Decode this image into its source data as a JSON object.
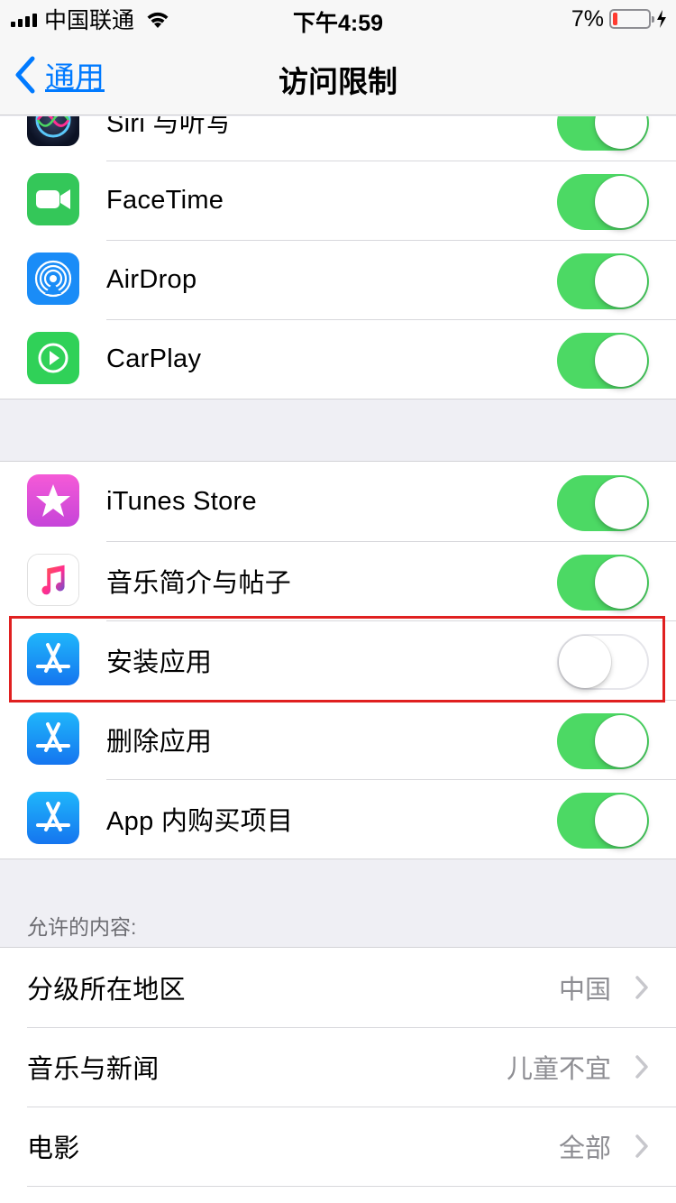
{
  "status_bar": {
    "carrier": "中国联通",
    "time": "下午4:59",
    "battery_percent": "7%",
    "battery_level": 0.07,
    "charging": true
  },
  "nav": {
    "back_label": "通用",
    "title": "访问限制"
  },
  "group1": {
    "items": [
      {
        "label": "Siri 与听写",
        "icon": "siri-icon",
        "enabled": true
      },
      {
        "label": "FaceTime",
        "icon": "facetime-icon",
        "enabled": true
      },
      {
        "label": "AirDrop",
        "icon": "airdrop-icon",
        "enabled": true
      },
      {
        "label": "CarPlay",
        "icon": "carplay-icon",
        "enabled": true
      }
    ]
  },
  "group2": {
    "items": [
      {
        "label": "iTunes Store",
        "icon": "itunes-store-icon",
        "enabled": true
      },
      {
        "label": "音乐简介与帖子",
        "icon": "music-icon",
        "enabled": true
      },
      {
        "label": "安装应用",
        "icon": "app-store-icon",
        "enabled": false,
        "highlighted": true
      },
      {
        "label": "删除应用",
        "icon": "app-store-icon",
        "enabled": true
      },
      {
        "label": "App 内购买项目",
        "icon": "app-store-icon",
        "enabled": true
      }
    ]
  },
  "allowed_content": {
    "header": "允许的内容:",
    "items": [
      {
        "label": "分级所在地区",
        "value": "中国"
      },
      {
        "label": "音乐与新闻",
        "value": "儿童不宜"
      },
      {
        "label": "电影",
        "value": "全部"
      }
    ]
  },
  "colors": {
    "accent": "#007aff",
    "toggle_on": "#4cd964",
    "highlight_border": "#e02020",
    "battery_low": "#ff3b30"
  }
}
